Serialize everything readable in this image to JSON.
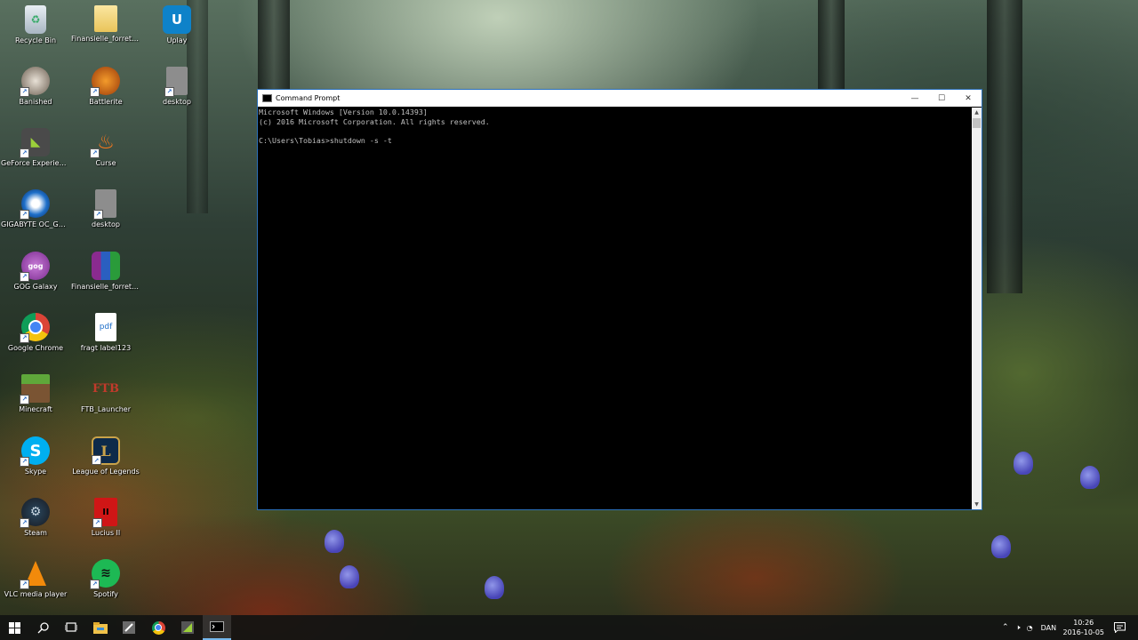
{
  "desktop": {
    "icons": [
      {
        "label": "Recycle Bin",
        "icon": "recycle-bin-icon"
      },
      {
        "label": "Finansielle_forretni...",
        "icon": "folder-icon"
      },
      {
        "label": "Uplay",
        "icon": "uplay-icon"
      },
      {
        "label": "Banished",
        "icon": "banished-icon"
      },
      {
        "label": "Battlerite",
        "icon": "battlerite-icon"
      },
      {
        "label": "desktop",
        "icon": "file-icon"
      },
      {
        "label": "GeForce Experience",
        "icon": "geforce-icon"
      },
      {
        "label": "Curse",
        "icon": "curse-icon"
      },
      {
        "label": "GIGABYTE OC_GURU",
        "icon": "gigabyte-icon"
      },
      {
        "label": "desktop",
        "icon": "file-icon"
      },
      {
        "label": "GOG Galaxy",
        "icon": "gog-icon"
      },
      {
        "label": "Finansielle_forretni...",
        "icon": "archive-icon"
      },
      {
        "label": "Google Chrome",
        "icon": "chrome-icon"
      },
      {
        "label": "fragt label123",
        "icon": "pdf-icon"
      },
      {
        "label": "Minecraft",
        "icon": "minecraft-icon"
      },
      {
        "label": "FTB_Launcher",
        "icon": "ftb-icon"
      },
      {
        "label": "Skype",
        "icon": "skype-icon"
      },
      {
        "label": "League of Legends",
        "icon": "league-icon"
      },
      {
        "label": "Steam",
        "icon": "steam-icon"
      },
      {
        "label": "Lucius II",
        "icon": "lucius-icon"
      },
      {
        "label": "VLC media player",
        "icon": "vlc-icon"
      },
      {
        "label": "Spotify",
        "icon": "spotify-icon"
      }
    ]
  },
  "cmd": {
    "title": "Command Prompt",
    "lines": [
      "Microsoft Windows [Version 10.0.14393]",
      "(c) 2016 Microsoft Corporation. All rights reserved.",
      "",
      "C:\\Users\\Tobias>shutdown -s -t"
    ],
    "buttons": {
      "minimize": "—",
      "maximize": "☐",
      "close": "✕"
    }
  },
  "taskbar": {
    "items": [
      "start-icon",
      "search-icon",
      "task-view-icon",
      "file-explorer-icon",
      "app-icon",
      "chrome-icon",
      "geforce-icon",
      "command-prompt-icon"
    ],
    "tray": {
      "language": "DAN",
      "time": "10:26",
      "date": "2016-10-05"
    }
  },
  "colors": {
    "accent": "#76b9ed",
    "console_text": "#c0c0c0",
    "console_bg": "#000000"
  }
}
